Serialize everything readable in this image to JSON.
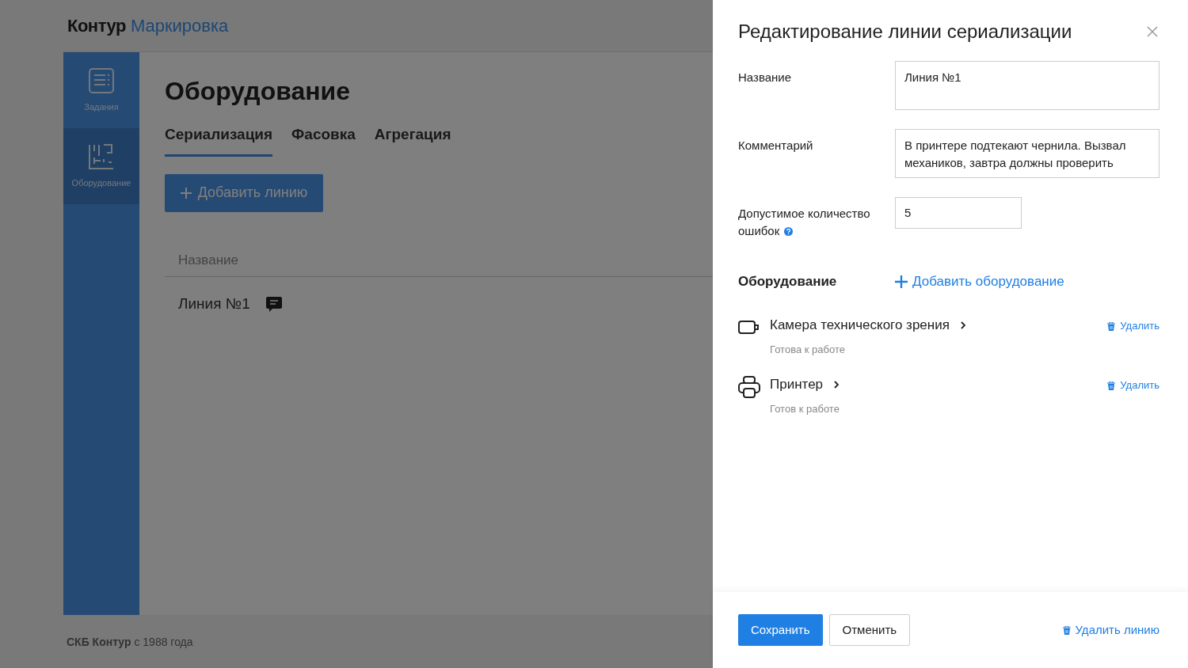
{
  "app": {
    "brand": "Контур",
    "product": "Маркировка"
  },
  "sidebar": {
    "items": [
      {
        "label": "Задания",
        "kind": "tasks",
        "selected": false
      },
      {
        "label": "Оборудование",
        "kind": "equipment",
        "selected": true
      }
    ]
  },
  "page": {
    "title": "Оборудование",
    "tabs": [
      {
        "label": "Сериализация",
        "selected": true
      },
      {
        "label": "Фасовка",
        "selected": false
      },
      {
        "label": "Агрегация",
        "selected": false
      }
    ],
    "add_button": "Добавить линию",
    "table": {
      "columns": [
        "Название"
      ],
      "rows": [
        {
          "name": "Линия №1",
          "has_comment": true
        }
      ]
    }
  },
  "footer": {
    "text": "**СКБ Контур** с 1988 года"
  },
  "panel": {
    "title": "Редактирование линии сериализации",
    "fields": [
      {
        "label": "Название",
        "value": "Линия №1",
        "kind": "textarea",
        "help": false
      },
      {
        "label": "Комментарий",
        "value": "В принтере подтекают чернила. Вызвал механиков, завтра должны проверить",
        "kind": "textarea",
        "help": false
      },
      {
        "label": "Допустимое количество ошибок",
        "value": "5",
        "kind": "number",
        "help": true
      }
    ],
    "equipment_heading": "Оборудование",
    "add_equipment": "Добавить оборудование",
    "equipment": [
      {
        "kind": "camera",
        "name": "Камера технического зрения",
        "status": "Готова к работе",
        "delete": "Удалить"
      },
      {
        "kind": "printer",
        "name": "Принтер",
        "status": "Готов к работе",
        "delete": "Удалить"
      }
    ],
    "save": "Сохранить",
    "cancel": "Отменить",
    "delete_line": "Удалить линию"
  }
}
